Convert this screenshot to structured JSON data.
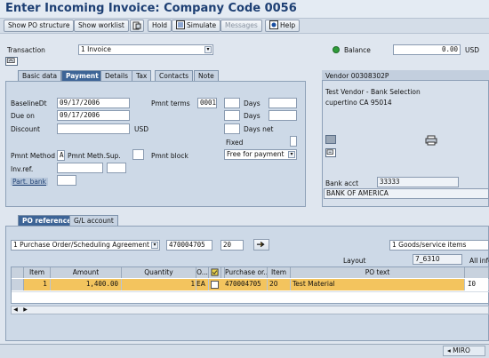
{
  "window": {
    "title": "Enter Incoming Invoice: Company Code 0056"
  },
  "toolbar": {
    "show_po_structure": "Show PO structure",
    "show_worklist": "Show worklist",
    "hold": "Hold",
    "simulate": "Simulate",
    "messages": "Messages",
    "help": "Help"
  },
  "header": {
    "transaction_label": "Transaction",
    "transaction_value": "1 Invoice",
    "balance_label": "Balance",
    "balance_value": "0.00",
    "currency": "USD"
  },
  "tabs": [
    "Basic data",
    "Payment",
    "Details",
    "Tax",
    "Contacts",
    "Note"
  ],
  "payment": {
    "baseline_label": "BaselineDt",
    "baseline_value": "09/17/2006",
    "due_label": "Due on",
    "due_value": "09/17/2006",
    "discount_label": "Discount",
    "discount_value": "",
    "discount_currency": "USD",
    "pmnt_terms_label": "Pmnt terms",
    "pmnt_terms_value": "0001",
    "days_label_1": "Days",
    "days_label_2": "Days",
    "days_net_label": "Days net",
    "fixed_label": "Fixed",
    "pmnt_method_label": "Pmnt Method",
    "pmnt_method_value": "A",
    "pmnt_method_text": "Pmnt Meth.Sup.",
    "pmnt_block_label": "Pmnt block",
    "pmnt_block_value": "Free for payment",
    "inv_ref_label": "Inv.ref.",
    "part_bank_label": "Part. bank"
  },
  "vendor": {
    "header": "Vendor 00308302P",
    "name": "Test Vendor - Bank Selection",
    "city": "cupertino CA  95014",
    "bank_acct_label": "Bank acct",
    "bank_acct_value": "33333",
    "bank_name": "BANK OF AMERICA"
  },
  "lower_tabs": [
    "PO reference",
    "G/L account"
  ],
  "po_ref": {
    "ref_type": "1 Purchase Order/Scheduling Agreement",
    "po_number": "470004705",
    "item": "20",
    "goods_items": "1 Goods/service items",
    "layout_label": "Layout",
    "layout_value": "7_6310",
    "all_info": "All info"
  },
  "table": {
    "columns": [
      "Item",
      "Amount",
      "Quantity",
      "O...",
      "",
      "",
      "Purchase or...",
      "Item",
      "PO text",
      ""
    ],
    "rows": [
      {
        "item": "1",
        "amount": "1,400.00",
        "quantity": "1",
        "unit": "EA",
        "po": "470004705",
        "po_item": "20",
        "po_text": "Test Material",
        "extra": "I0"
      }
    ]
  },
  "status": {
    "system": "MIRO"
  }
}
